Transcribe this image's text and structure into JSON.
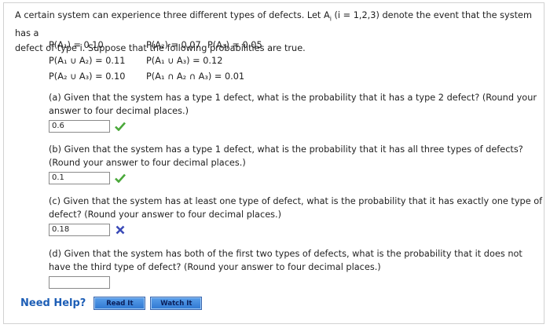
{
  "intro": {
    "line1": "A certain system can experience three different types of defects. Let A",
    "line1_sub": "i",
    "line1_rest": " (i = 1,2,3) denote the event that the system has a",
    "line2": "defect of type i. Suppose that the following probabilities are true."
  },
  "probabilities": {
    "r1c1": "P(A₁) = 0.10",
    "r1c2": "P(A₂) = 0.07",
    "r1c3": "P(A₃) = 0.05",
    "r2c1": "P(A₁ ∪ A₂) = 0.11",
    "r2c2": "P(A₁ ∪ A₃) = 0.12",
    "r3c1": "P(A₂ ∪ A₃) = 0.10",
    "r3c2": "P(A₁ ∩ A₂ ∩ A₃) = 0.01"
  },
  "questions": [
    {
      "text": "(a) Given that the system has a type 1 defect, what is the probability that it has a type 2 defect? (Round your answer to four decimal places.)",
      "answer": "0.6",
      "status": "correct"
    },
    {
      "text": "(b) Given that the system has a type 1 defect, what is the probability that it has all three types of defects? (Round your answer to four decimal places.)",
      "answer": "0.1",
      "status": "correct"
    },
    {
      "text": "(c) Given that the system has at least one type of defect, what is the probability that it has exactly one type of defect? (Round your answer to four decimal places.)",
      "answer": "0.18",
      "status": "incorrect"
    },
    {
      "text": "(d) Given that the system has both of the first two types of defects, what is the probability that it does not have the third type of defect? (Round your answer to four decimal places.)",
      "answer": "",
      "status": "none"
    }
  ],
  "help": {
    "label": "Need Help?",
    "read_button": "Read It",
    "watch_button": "Watch It"
  },
  "colors": {
    "check": "#4aa83a",
    "cross": "#3b4bb8",
    "help_text": "#1d5eb6",
    "button": "#2f78d2"
  }
}
